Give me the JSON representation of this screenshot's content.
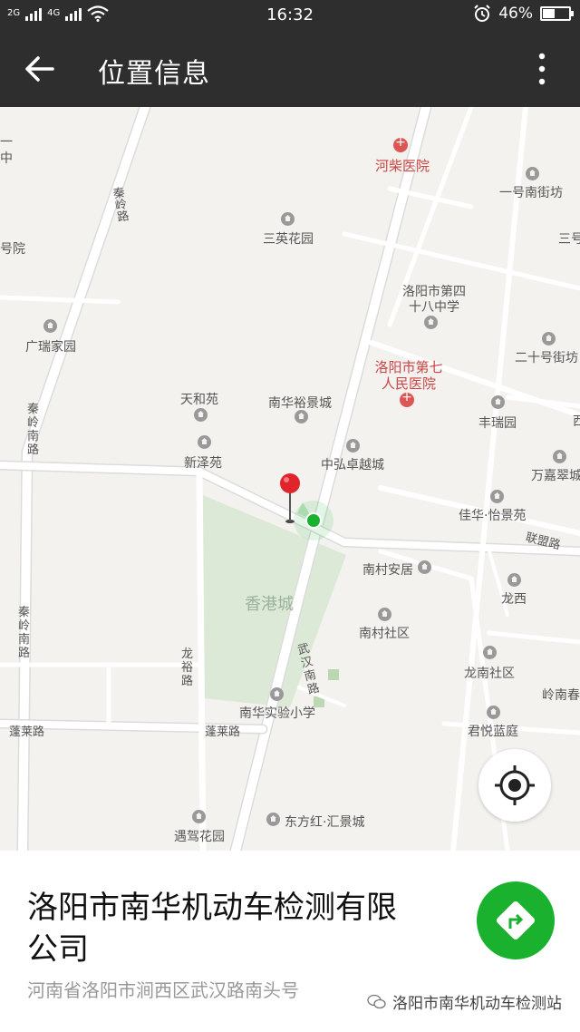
{
  "status_bar": {
    "network_left": "2G",
    "network_right": "4G",
    "time": "16:32",
    "battery_percent": "46%",
    "battery_level": 0.46,
    "icons": [
      "signal-icon",
      "wifi-icon",
      "alarm-icon",
      "battery-icon"
    ]
  },
  "app_bar": {
    "title": "位置信息",
    "back_icon": "arrow-left-icon",
    "menu_icon": "more-vertical-icon"
  },
  "map": {
    "pois": [
      {
        "name": "河柴医院",
        "type": "hospital"
      },
      {
        "name": "一号南街坊",
        "type": "place"
      },
      {
        "name": "三英花园",
        "type": "place"
      },
      {
        "name": "三号",
        "type": "place"
      },
      {
        "name": "号院",
        "type": "place"
      },
      {
        "name": "洛阳市第四十八中学",
        "type": "school"
      },
      {
        "name": "广瑞家园",
        "type": "place"
      },
      {
        "name": "二十号街坊",
        "type": "place"
      },
      {
        "name": "洛阳市第七人民医院",
        "type": "hospital"
      },
      {
        "name": "天和苑",
        "type": "place"
      },
      {
        "name": "南华裕景城",
        "type": "place"
      },
      {
        "name": "丰瑞园",
        "type": "place"
      },
      {
        "name": "新泽苑",
        "type": "place"
      },
      {
        "name": "中弘卓越城",
        "type": "place"
      },
      {
        "name": "万嘉翠城",
        "type": "place"
      },
      {
        "name": "佳华·怡景苑",
        "type": "place"
      },
      {
        "name": "南村安居",
        "type": "place"
      },
      {
        "name": "龙西",
        "type": "place"
      },
      {
        "name": "香港城",
        "type": "area"
      },
      {
        "name": "南村社区",
        "type": "place"
      },
      {
        "name": "龙南社区",
        "type": "place"
      },
      {
        "name": "岭南春",
        "type": "place"
      },
      {
        "name": "南华实验小学",
        "type": "school"
      },
      {
        "name": "君悦蓝庭",
        "type": "place"
      },
      {
        "name": "东方红·汇景城",
        "type": "place"
      },
      {
        "name": "遇驾花园",
        "type": "place"
      }
    ],
    "roads": {
      "qinling": "秦岭路",
      "qinling_south": "秦岭南路",
      "qinling_south_2": "秦岭南路",
      "wuhan_south": "武汉南路",
      "longyu": "龙裕路",
      "penglai_1": "蓬莱路",
      "penglai_2": "蓬莱路",
      "lianmeng": "联盟路"
    },
    "fragments": {
      "top_left_1": "一",
      "top_left_2": "中",
      "right_edge": "西"
    },
    "pin": {
      "icon": "map-pin-icon"
    },
    "my_location": {
      "icon": "current-location-icon"
    },
    "locate_button_icon": "crosshair-icon"
  },
  "info": {
    "place_name": "洛阳市南华机动车检测有限公司",
    "address": "河南省洛阳市涧西区武汉路南头号",
    "navigate_icon": "navigate-arrow-icon",
    "watermark": "洛阳市南华机动车检测站"
  },
  "colors": {
    "bar": "#2e2e2e",
    "accent_green": "#1ab12e",
    "pin_red": "#e0242a",
    "map_bg": "#f3f2ef",
    "park": "#dde9d7"
  }
}
